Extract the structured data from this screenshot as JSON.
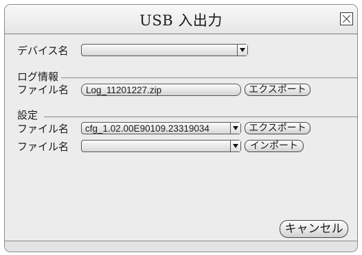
{
  "window": {
    "title": "USB 入出力"
  },
  "device": {
    "label": "デバイス名",
    "value": ""
  },
  "log_section": {
    "heading": "ログ情報",
    "file_label": "ファイル名",
    "file_value": "Log_11201227.zip",
    "export_label": "エクスポート"
  },
  "settings_section": {
    "heading": "設定",
    "rows": [
      {
        "file_label": "ファイル名",
        "file_value": "cfg_1.02.00E90109.23319034",
        "button_label": "エクスポート"
      },
      {
        "file_label": "ファイル名",
        "file_value": "",
        "button_label": "インポート"
      }
    ]
  },
  "footer": {
    "cancel_label": "キャンセル"
  }
}
